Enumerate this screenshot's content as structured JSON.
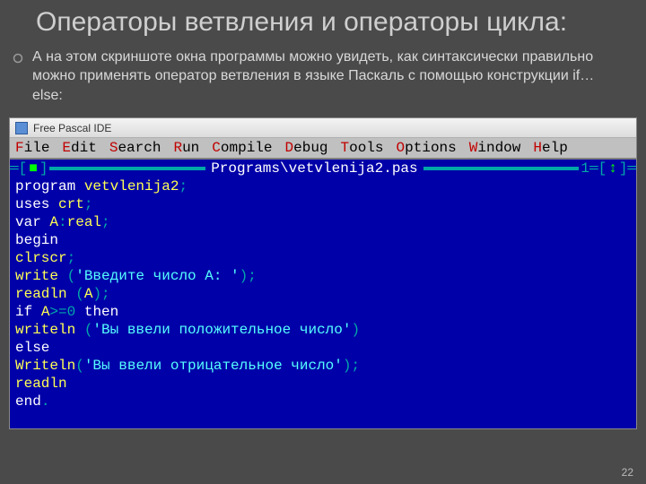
{
  "slide": {
    "title": "Операторы ветвления и операторы цикла:",
    "bullet": "А на этом скриншоте окна программы можно увидеть, как синтаксически правильно можно применять оператор ветвления в языке Паскаль с помощью конструкции if…else:",
    "page_number": "22"
  },
  "ide": {
    "window_title": "Free Pascal IDE",
    "menu": [
      {
        "hot": "F",
        "rest": "ile"
      },
      {
        "hot": "E",
        "rest": "dit"
      },
      {
        "hot": "S",
        "rest": "earch"
      },
      {
        "hot": "R",
        "rest": "un"
      },
      {
        "hot": "C",
        "rest": "ompile"
      },
      {
        "hot": "D",
        "rest": "ebug"
      },
      {
        "hot": "T",
        "rest": "ools"
      },
      {
        "hot": "O",
        "rest": "ptions"
      },
      {
        "hot": "W",
        "rest": "indow"
      },
      {
        "hot": "H",
        "rest": "elp"
      }
    ],
    "frame": {
      "left_marker": "■",
      "title": "Programs\\vetvlenija2.pas",
      "right_number": "1",
      "right_marker": "↕"
    },
    "code": {
      "l1": {
        "kw": "program ",
        "ident": "vetvlenija2",
        "semi": ";"
      },
      "l2": {
        "kw": "uses ",
        "ident": "crt",
        "semi": ";"
      },
      "l3": {
        "kw": "var ",
        "ident": "A",
        "colon": ":",
        "type": "real",
        "semi": ";"
      },
      "l4": {
        "kw": "begin"
      },
      "l5": {
        "ident": "clrscr",
        "semi": ";"
      },
      "l6": {
        "ident": "write ",
        "lp": "(",
        "str": "'Введите число A: '",
        "rp": ")",
        "semi": ";"
      },
      "l7": {
        "ident": "readln ",
        "lp": "(",
        "arg": "A",
        "rp": ")",
        "semi": ";"
      },
      "l8": {
        "kw": "if ",
        "ident": "A",
        "op": ">=",
        "num": "0",
        "then": " then"
      },
      "l9": {
        "ident": "writeln ",
        "lp": "(",
        "str": "'Вы ввели положительное число'",
        "rp": ")"
      },
      "l10": {
        "kw": "else"
      },
      "l11": {
        "ident": "Writeln",
        "lp": "(",
        "str": "'Вы ввели отрицательное число'",
        "rp": ")",
        "semi": ";"
      },
      "l12": {
        "ident": "readln"
      },
      "l13": {
        "kw": "end",
        "dot": "."
      }
    }
  }
}
